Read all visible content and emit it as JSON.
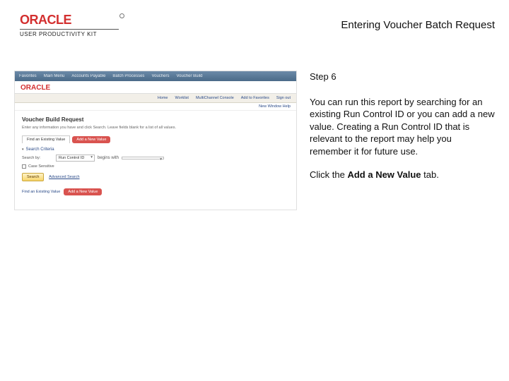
{
  "header": {
    "logo_text": "ORACLE",
    "logo_subtitle": "USER PRODUCTIVITY KIT",
    "title": "Entering Voucher Batch Request"
  },
  "instructions": {
    "step_label": "Step 6",
    "body": "You can run this report by searching for an existing Run Control ID or you can add a new value. Creating a Run Control ID that is relevant to the report may help you remember it for future use.",
    "action_prefix": "Click the ",
    "action_bold": "Add a New Value",
    "action_suffix": " tab."
  },
  "shot": {
    "topnav": [
      "Favorites",
      "Main Menu",
      "Accounts Payable",
      "Batch Processes",
      "Vouchers",
      "Voucher Build"
    ],
    "brand": "ORACLE",
    "nav_items": [
      "Home",
      "Worklist",
      "MultiChannel Console",
      "Add to Favorites",
      "Sign out"
    ],
    "subnav": "New Window  Help",
    "page_title": "Voucher Build Request",
    "intro_text": "Enter any information you have and click Search. Leave fields blank for a list of all values.",
    "tab_active": "Find an Existing Value",
    "tab_other": "Add a New Value",
    "section_title": "Search Criteria",
    "field_label": "Search by:",
    "dd_value": "Run Control ID",
    "dd_suffix": "begins with",
    "checkbox_label": "Case Sensitive",
    "btn_search": "Search",
    "link_advanced": "Advanced Search",
    "footer_label": "Find an Existing Value",
    "footer_pill": "Add a New Value"
  }
}
